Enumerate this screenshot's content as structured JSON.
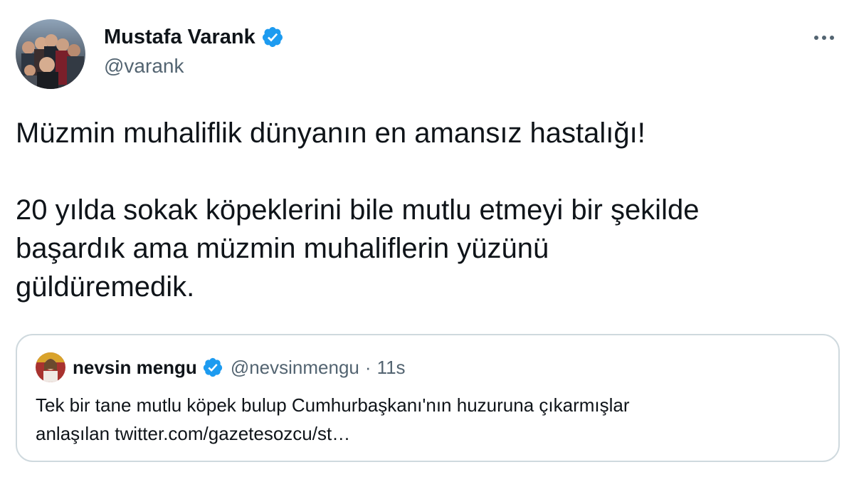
{
  "tweet": {
    "author": {
      "name": "Mustafa Varank",
      "handle": "@varank",
      "verified": true
    },
    "text_lines": [
      "Müzmin muhaliflik dünyanın en amansız hastalığı!",
      "20 yılda sokak köpeklerini bile mutlu etmeyi bir şekilde",
      "başardık ama müzmin muhaliflerin yüzünü",
      "güldüremedik."
    ],
    "menu_icon": "more-horizontal-icon",
    "quoted": {
      "name": "nevsin mengu",
      "handle": "@nevsinmengu",
      "separator": "·",
      "time": "11s",
      "verified": true,
      "text_lines": [
        "Tek bir tane mutlu köpek bulup Cumhurbaşkanı'nın huzuruna çıkarmışlar",
        "anlaşılan twitter.com/gazetesozcu/st…"
      ]
    }
  },
  "colors": {
    "text_primary": "#0f1419",
    "text_secondary": "#536471",
    "verified_blue": "#1d9bf0",
    "border": "#cfd9de"
  }
}
